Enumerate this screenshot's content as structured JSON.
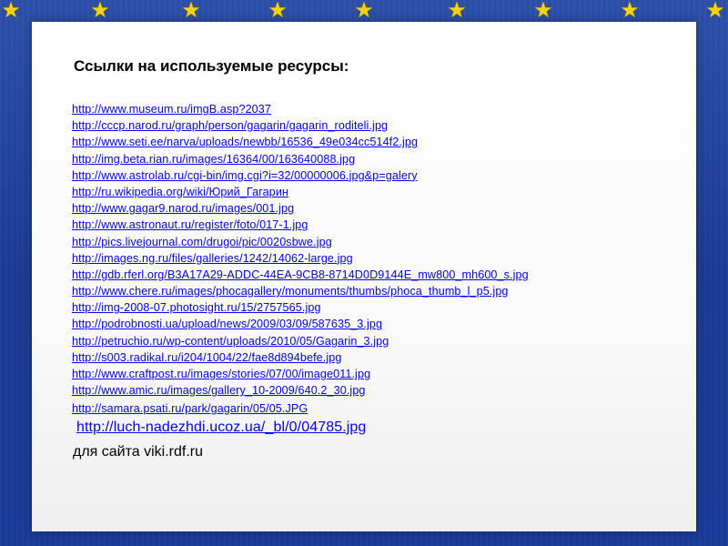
{
  "heading": "Ссылки на используемые ресурсы:",
  "links": [
    "http://www.museum.ru/imgB.asp?2037",
    "http://cccp.narod.ru/graph/person/gagarin/gagarin_roditeli.jpg",
    "http://www.seti.ee/narva/uploads/newbb/16536_49e034cc514f2.jpg",
    "http://img.beta.rian.ru/images/16364/00/163640088.jpg",
    "http://www.astrolab.ru/cgi-bin/img.cgi?i=32/00000006.jpg&p=galery",
    "http://ru.wikipedia.org/wiki/Юрий_Гагарин",
    "http://www.gagar9.narod.ru/images/001.jpg",
    "http://www.astronaut.ru/register/foto/017-1.jpg",
    "http://pics.livejournal.com/drugoi/pic/0020sbwe.jpg",
    "http://images.ng.ru/files/galleries/1242/14062-large.jpg",
    "http://gdb.rferl.org/B3A17A29-ADDC-44EA-9CB8-8714D0D9144E_mw800_mh600_s.jpg",
    "http://www.chere.ru/images/phocagallery/monuments/thumbs/phoca_thumb_l_p5.jpg",
    "http://img-2008-07.photosight.ru/15/2757565.jpg",
    "http://podrobnosti.ua/upload/news/2009/03/09/587635_3.jpg",
    "http://petruchio.ru/wp-content/uploads/2010/05/Gagarin_3.jpg",
    "http://s003.radikal.ru/i204/1004/22/fae8d894befe.jpg",
    "http://www.craftpost.ru/images/stories/07/00/image011.jpg",
    "http://www.amic.ru/images/gallery_10-2009/640.2_30.jpg"
  ],
  "link_extra": "http://samara.psati.ru/park/gagarin/05/05.JPG",
  "link_big": "http://luch-nadezhdi.ucoz.ua/_bl/0/04785.jpg",
  "footer": "для сайта viki.rdf.ru",
  "colors": {
    "frame": "#1f3a8f",
    "star": "#f5d21a",
    "link": "#0000ff"
  },
  "decor": {
    "star_icon": "star-icon",
    "star_count": 9
  }
}
